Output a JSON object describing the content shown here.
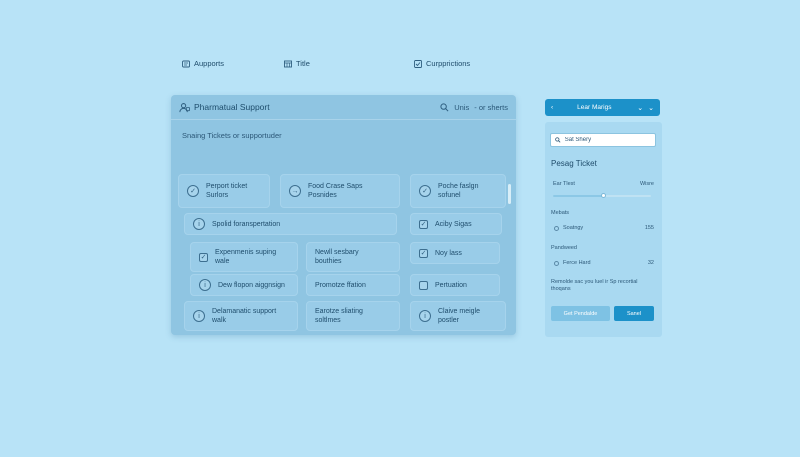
{
  "app": {
    "title": "Pharmatual Support",
    "header_right_label": "Unis",
    "header_right_link": "- or sherts"
  },
  "main": {
    "subtitle": "Snaing Tickets or supportuder",
    "columns": [
      {
        "label": "Aupports",
        "icon": "ticket-icon"
      },
      {
        "label": "Title",
        "icon": "table-icon"
      },
      {
        "label": "Curpprictions",
        "icon": "checkbox-icon"
      }
    ],
    "cells": [
      {
        "text": "Perport ticket\nSurlors",
        "icon": "check-circle-icon"
      },
      {
        "text": "Food Crase Saps\nPosnides",
        "icon": "arrow-right-icon"
      },
      {
        "text": "Poche faslgn\nsofunel",
        "icon": "check-circle-icon"
      },
      {
        "text": "Spolid foranspertation",
        "icon": "info-circle-icon"
      },
      {
        "text": "Aciby Sigas",
        "icon": "check-square-icon"
      },
      {
        "text": "Expenmenis suping\nwale",
        "icon": "check-square-icon"
      },
      {
        "text": "Newll sesbary\nbouthies",
        "icon": ""
      },
      {
        "text": "Noy lass",
        "icon": "check-square-icon"
      },
      {
        "text": "Dew flopon aiggnsign",
        "icon": "info-circle-icon"
      },
      {
        "text": "Promotze ffation",
        "icon": ""
      },
      {
        "text": "Pertuation",
        "icon": "square-icon"
      },
      {
        "text": "Delamanatic support\nwalk",
        "icon": "info-circle-icon"
      },
      {
        "text": "Earotze sliating\nsoltlmes",
        "icon": ""
      },
      {
        "text": "Claive meigle\npostler",
        "icon": "info-circle-icon"
      }
    ]
  },
  "side": {
    "header_title": "Lear Marigs",
    "search_value": "Sat Shery",
    "section_title": "Pesag Ticket",
    "slider": {
      "left_label": "Ear Tlest",
      "right_label": "Wisre",
      "level": 0.52
    },
    "group1_label": "Mebats",
    "row1": {
      "label": "Soatngy",
      "count": "155"
    },
    "group2_label": "Pandweed",
    "row2": {
      "label": "Ferce Hard",
      "count": "32"
    },
    "note": "Remolde sac you luel ir Sp recortial thoqans",
    "secondary_button": "Get Pendalde",
    "primary_button": "Sanel"
  }
}
